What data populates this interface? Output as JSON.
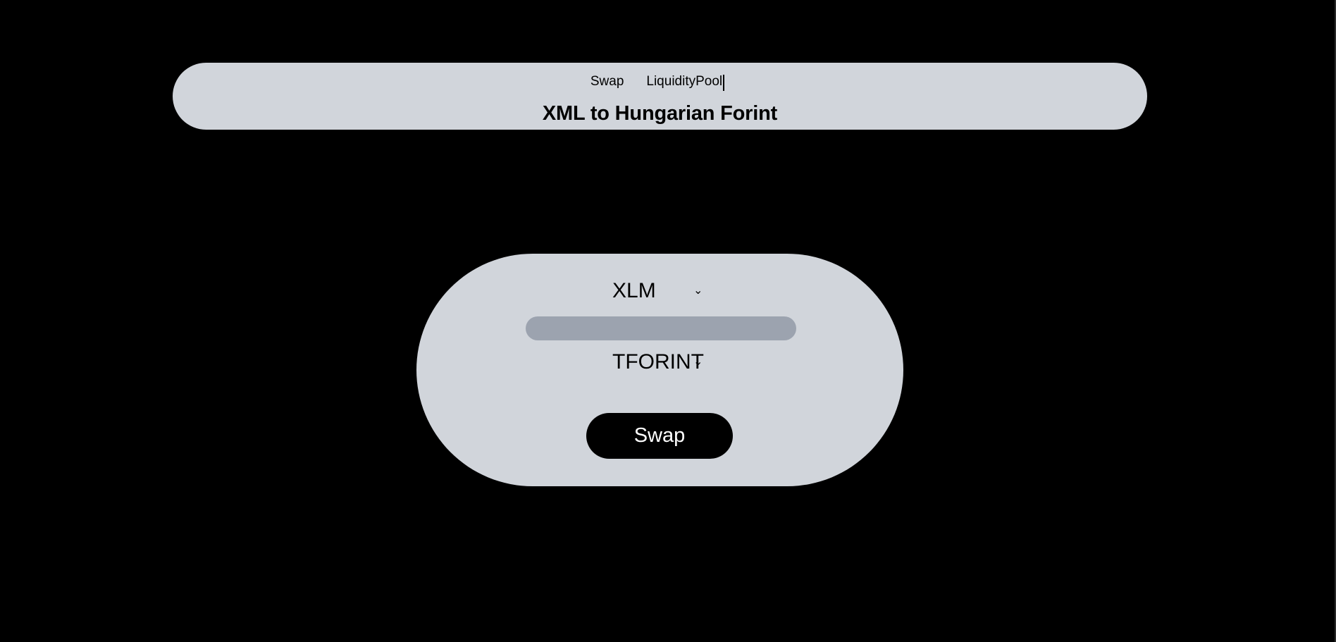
{
  "header": {
    "nav": [
      {
        "label": "Swap"
      },
      {
        "label": "LiquidityPool"
      }
    ],
    "title": "XML to Hungarian Forint"
  },
  "swap": {
    "from_token": "XLM",
    "to_token": "TFORINT",
    "amount_value": "",
    "button_label": "Swap",
    "chevron": "⌄"
  },
  "colors": {
    "background": "#000000",
    "panel": "#d1d5db",
    "input": "#9ca3af",
    "button": "#000000"
  }
}
